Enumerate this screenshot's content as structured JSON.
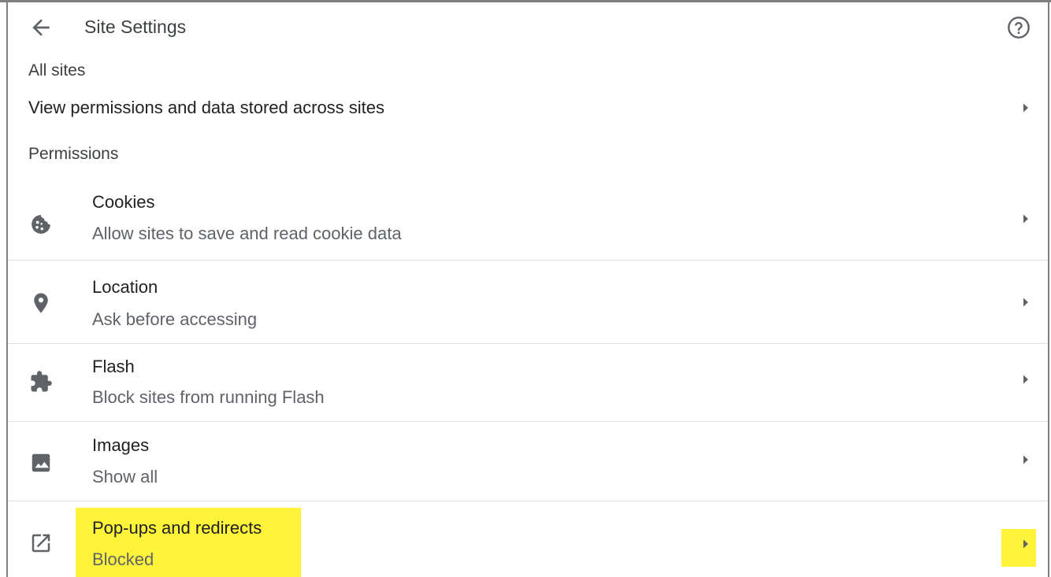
{
  "header": {
    "title": "Site Settings",
    "back_icon": "arrow-back-icon",
    "help_icon": "help-icon"
  },
  "all_sites": {
    "section_label": "All sites",
    "row_label": "View permissions and data stored across sites"
  },
  "permissions": {
    "section_label": "Permissions",
    "items": [
      {
        "title": "Cookies",
        "subtitle": "Allow sites to save and read cookie data",
        "icon": "cookie-icon"
      },
      {
        "title": "Location",
        "subtitle": "Ask before accessing",
        "icon": "location-pin-icon"
      },
      {
        "title": "Flash",
        "subtitle": "Block sites from running Flash",
        "icon": "puzzle-piece-icon"
      },
      {
        "title": "Images",
        "subtitle": "Show all",
        "icon": "image-icon"
      },
      {
        "title": "Pop-ups and redirects",
        "subtitle": "Blocked",
        "icon": "open-in-new-icon",
        "highlighted": true
      }
    ]
  },
  "colors": {
    "highlight": "#fff43a",
    "icon": "#5f6368",
    "divider": "#e0e0e0"
  }
}
